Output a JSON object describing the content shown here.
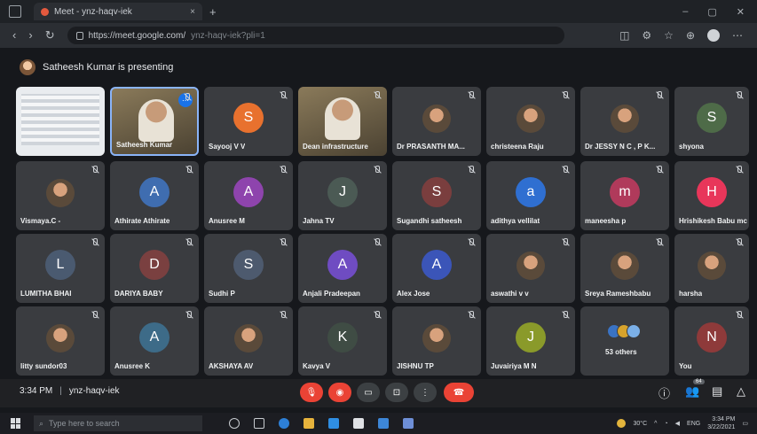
{
  "browser": {
    "tab_title": "Meet - ynz-haqv-iek",
    "tab_close": "×",
    "new_tab": "+",
    "url_domain": "https://meet.google.com/",
    "url_path": "ynz-haqv-iek?pli=1",
    "min_label": "–",
    "max_label": "▢",
    "close_label": "✕"
  },
  "presenting": {
    "text": "Satheesh Kumar is presenting"
  },
  "tiles": [
    {
      "name": "",
      "kind": "screen"
    },
    {
      "name": "Satheesh Kumar",
      "kind": "video",
      "tag": "⋯"
    },
    {
      "name": "Sayooj V V",
      "initial": "S",
      "color": "#e8712e"
    },
    {
      "name": "Dean infrastructure",
      "kind": "video"
    },
    {
      "name": "Dr PRASANTH MA...",
      "kind": "photo"
    },
    {
      "name": "christeena Raju",
      "kind": "photo"
    },
    {
      "name": "Dr JESSY N C , P K...",
      "kind": "photo"
    },
    {
      "name": "shyona",
      "initial": "S",
      "color": "#4e6b48"
    },
    {
      "name": "Vismaya.C -",
      "kind": "photo"
    },
    {
      "name": "Athirate Athirate",
      "initial": "A",
      "color": "#3f6db0"
    },
    {
      "name": "Anusree M",
      "initial": "A",
      "color": "#8e44ad"
    },
    {
      "name": "Jahna TV",
      "initial": "J",
      "color": "#4b5a54"
    },
    {
      "name": "Sugandhi satheesh",
      "initial": "S",
      "color": "#7a3e3e"
    },
    {
      "name": "adithya vellilat",
      "initial": "a",
      "color": "#2f6fd1"
    },
    {
      "name": "maneesha p",
      "initial": "m",
      "color": "#b03a5b"
    },
    {
      "name": "Hrishikesh Babu mc",
      "initial": "H",
      "color": "#e8365a"
    },
    {
      "name": "LUMITHA BHAI",
      "initial": "L",
      "color": "#4a5a70"
    },
    {
      "name": "DARIYA BABY",
      "initial": "D",
      "color": "#7a4040"
    },
    {
      "name": "Sudhi P",
      "initial": "S",
      "color": "#4d5a6e"
    },
    {
      "name": "Anjali Pradeepan",
      "initial": "A",
      "color": "#6f4cc2"
    },
    {
      "name": "Alex Jose",
      "initial": "A",
      "color": "#3b55b8"
    },
    {
      "name": "aswathi v v",
      "kind": "photo"
    },
    {
      "name": "Sreya Rameshbabu",
      "kind": "photo"
    },
    {
      "name": "harsha",
      "kind": "photo"
    },
    {
      "name": "litty sundor03",
      "kind": "photo"
    },
    {
      "name": "Anusree K",
      "initial": "A",
      "color": "#3d6b88"
    },
    {
      "name": "AKSHAYA AV",
      "kind": "photo"
    },
    {
      "name": "Kavya V",
      "initial": "K",
      "color": "#3f4c44"
    },
    {
      "name": "JISHNU TP",
      "kind": "photo"
    },
    {
      "name": "Juvairiya M N",
      "initial": "J",
      "color": "#8a9a2a"
    },
    {
      "name": "53 others",
      "kind": "others"
    },
    {
      "name": "You",
      "initial": "N",
      "color": "#8e3a3a"
    }
  ],
  "controls": {
    "time": "3:34 PM",
    "separator": "|",
    "meeting_code": "ynz-haqv-iek",
    "participants_count": "64"
  },
  "taskbar": {
    "search_placeholder": "Type here to search",
    "weather": "30°C",
    "lang": "ENG",
    "time": "3:34 PM",
    "date": "3/22/2021"
  }
}
